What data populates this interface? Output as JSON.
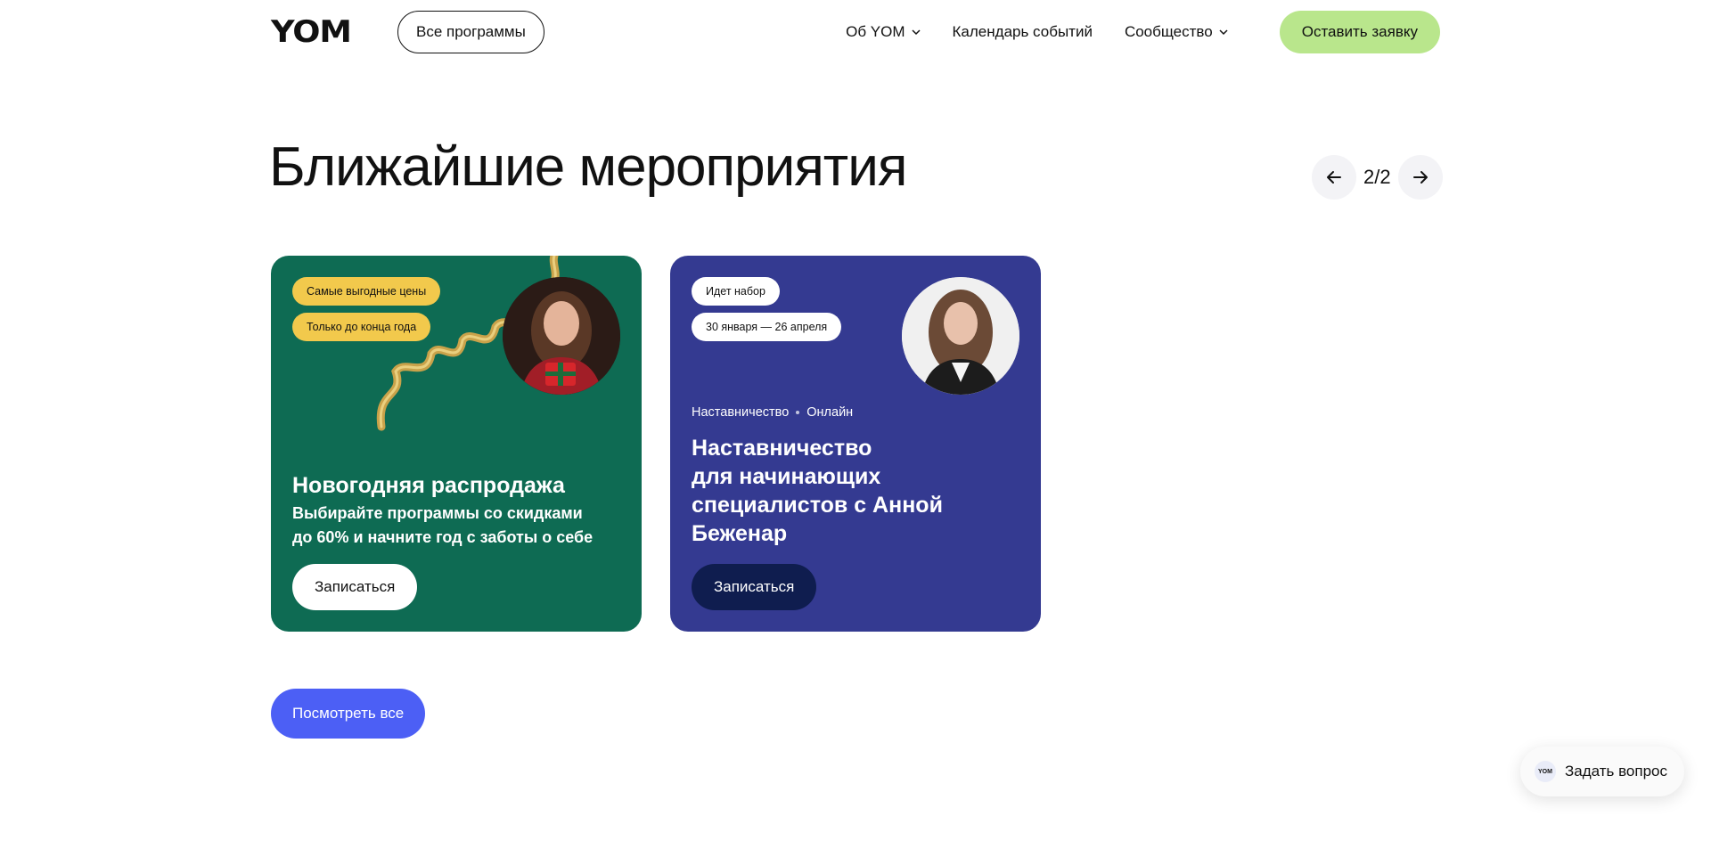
{
  "header": {
    "logo": "YOM",
    "all_programs": "Все программы",
    "nav": [
      {
        "label": "Об YOM"
      },
      {
        "label": "Календарь событий"
      },
      {
        "label": "Сообщество"
      }
    ],
    "apply": "Оставить заявку"
  },
  "section": {
    "title": "Ближайшие мероприятия",
    "pager": "2/2"
  },
  "cards": [
    {
      "badges": [
        "Самые выгодные цены",
        "Только до конца года"
      ],
      "title": "Новогодняя распродажа",
      "subtitle_line1": "Выбирайте программы со скидками",
      "subtitle_line2": "до 60% и начните год с заботы о себе",
      "button": "Записаться",
      "bg_color": "#0e6b53"
    },
    {
      "badges": [
        "Идет набор",
        "30 января — 26 апреля"
      ],
      "meta": [
        "Наставничество",
        "Онлайн"
      ],
      "title_lines": [
        "Наставничество",
        "для начинающих",
        "специалистов с Анной",
        "Беженар"
      ],
      "button": "Записаться",
      "bg_color": "#343a91"
    }
  ],
  "view_all": "Посмотреть все",
  "ask": {
    "logo": "YOM",
    "label": "Задать вопрос"
  },
  "colors": {
    "accent_green": "#b9e68c",
    "accent_blue": "#4c5ff5",
    "badge_yellow": "#f2c94c"
  }
}
